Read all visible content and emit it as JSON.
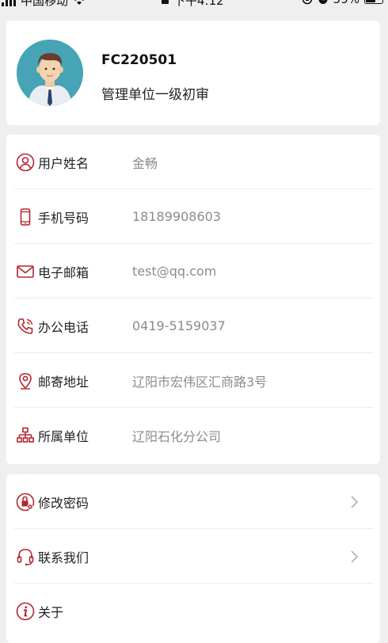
{
  "status_bar": {
    "carrier": "中国移动",
    "time": "下午4:12",
    "battery": "59%"
  },
  "profile": {
    "code": "FC220501",
    "role": "管理单位一级初审"
  },
  "info": [
    {
      "label": "用户姓名",
      "value": "金畅",
      "icon": "user-icon"
    },
    {
      "label": "手机号码",
      "value": "18189908603",
      "icon": "mobile-phone-icon"
    },
    {
      "label": "电子邮箱",
      "value": "test@qq.com",
      "icon": "mail-icon"
    },
    {
      "label": "办公电话",
      "value": "0419-5159037",
      "icon": "phone-icon"
    },
    {
      "label": "邮寄地址",
      "value": "辽阳市宏伟区汇商路3号",
      "icon": "location-pin-icon"
    },
    {
      "label": "所属单位",
      "value": "辽阳石化分公司",
      "icon": "organization-icon"
    }
  ],
  "menu": [
    {
      "label": "修改密码",
      "icon": "lock-settings-icon"
    },
    {
      "label": "联系我们",
      "icon": "headset-icon"
    },
    {
      "label": "关于",
      "icon": "info-icon"
    }
  ],
  "colors": {
    "accent": "#b3262d",
    "background": "#efefef",
    "value_text": "#8b8b8b"
  }
}
